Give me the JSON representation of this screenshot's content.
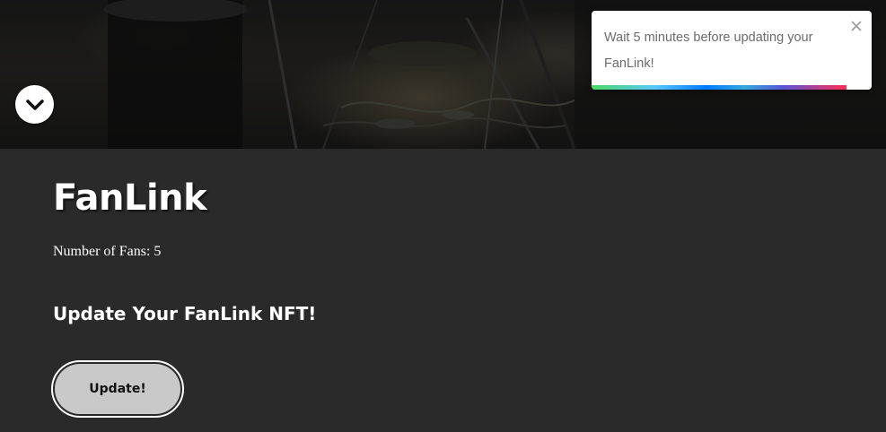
{
  "hero": {
    "scroll_icon": "chevron-down-icon"
  },
  "toast": {
    "message": "Wait 5 minutes before updating your FanLink!",
    "close_icon": "close-icon",
    "progress": 0.91
  },
  "main": {
    "title": "FanLink",
    "fans_text": "Number of Fans: 5",
    "subtitle": "Update Your FanLink NFT!",
    "update_label": "Update!"
  },
  "colors": {
    "background": "#2a2a2a",
    "button_fill": "#c9c9c9",
    "toast_bg": "#ffffff"
  }
}
